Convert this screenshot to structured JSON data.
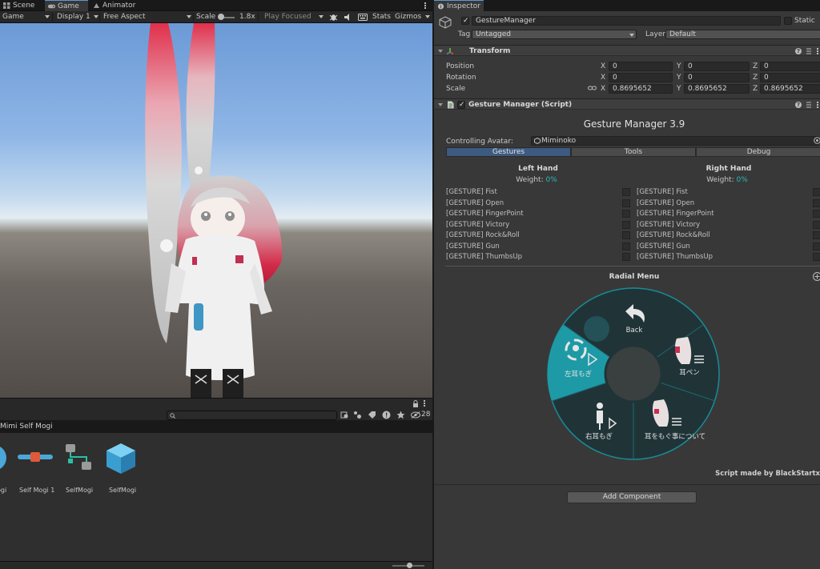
{
  "left_tabs": [
    {
      "label": "Scene"
    },
    {
      "label": "Game"
    },
    {
      "label": "Animator"
    }
  ],
  "game_toolbar": {
    "mode": "Game",
    "display": "Display 1",
    "aspect": "Free Aspect",
    "scale_label": "Scale",
    "scale_value": "1.8x",
    "play_focused": "Play Focused",
    "stats": "Stats",
    "gizmos": "Gizmos"
  },
  "project": {
    "hidden_count": "28",
    "folder_title": "Mimi Self Mogi",
    "assets": [
      {
        "label": "ogi",
        "icon": "blue-circle-icon"
      },
      {
        "label": "Self Mogi 1",
        "icon": "slider-prefab-icon"
      },
      {
        "label": "SelfMogi",
        "icon": "animator-controller-icon"
      },
      {
        "label": "SelfMogi",
        "icon": "prefab-cube-icon"
      }
    ]
  },
  "inspector": {
    "tab_label": "Inspector",
    "object_name": "GestureManager",
    "static_label": "Static",
    "tag_label": "Tag",
    "tag_value": "Untagged",
    "layer_label": "Layer",
    "layer_value": "Default",
    "transform": {
      "title": "Transform",
      "position": {
        "label": "Position",
        "x": "0",
        "y": "0",
        "z": "0"
      },
      "rotation": {
        "label": "Rotation",
        "x": "0",
        "y": "0",
        "z": "0"
      },
      "scale": {
        "label": "Scale",
        "x": "0.8695652",
        "y": "0.8695652",
        "z": "0.8695652"
      },
      "axis_x": "X",
      "axis_y": "Y",
      "axis_z": "Z"
    },
    "script": {
      "title": "Gesture Manager (Script)",
      "heading": "Gesture Manager 3.9",
      "controlling_label": "Controlling Avatar:",
      "avatar_name": "Miminoko",
      "tabs": [
        {
          "label": "Gestures",
          "selected": true
        },
        {
          "label": "Tools",
          "selected": false
        },
        {
          "label": "Debug",
          "selected": false
        }
      ],
      "left_hand": {
        "title": "Left Hand",
        "weight_label": "Weight:",
        "weight_value": "0%"
      },
      "right_hand": {
        "title": "Right Hand",
        "weight_label": "Weight:",
        "weight_value": "0%"
      },
      "gestures": [
        "[GESTURE] Fist",
        "[GESTURE] Open",
        "[GESTURE] FingerPoint",
        "[GESTURE] Victory",
        "[GESTURE] Rock&Roll",
        "[GESTURE] Gun",
        "[GESTURE] ThumbsUp"
      ],
      "radial_menu_title": "Radial Menu",
      "radial": {
        "back": "Back",
        "left_ear": "左耳もぎ",
        "ear_pen": "耳ペン",
        "right_ear": "右耳もぎ",
        "about": "耳をもぐ事について"
      },
      "credit": "Script made by BlackStartx"
    },
    "add_component": "Add Component"
  },
  "colors": {
    "accent_blue": "#3d5a80",
    "teal": "#1e9aa6",
    "panel": "#383838"
  }
}
